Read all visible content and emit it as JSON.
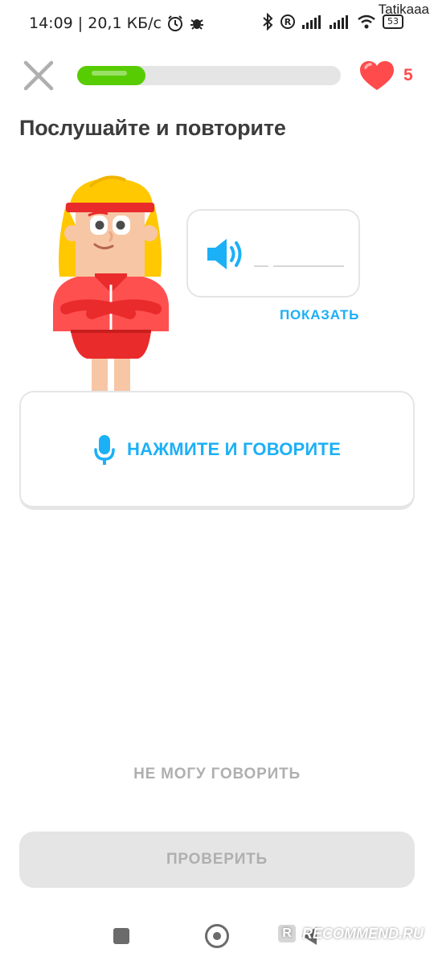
{
  "status_bar": {
    "time_speed": "14:09 | 20,1 КБ/с",
    "battery": "53",
    "icons": [
      "alarm-icon",
      "bug-icon",
      "bluetooth-icon",
      "roaming-icon",
      "signal-icon",
      "wifi-icon",
      "battery-icon"
    ]
  },
  "watermark": {
    "user": "Tatikaaa",
    "site": "RECOMMEND.RU",
    "badge": "R"
  },
  "header": {
    "progress": 0.26,
    "hearts_count": "5"
  },
  "title": "Послушайте и повторите",
  "bubble": {
    "speaker_icon": "speaker-icon"
  },
  "show_label": "ПОКАЗАТЬ",
  "speak_button": {
    "label": "НАЖМИТЕ И ГОВОРИТЕ",
    "icon": "microphone-icon"
  },
  "cant_speak_label": "НЕ МОГУ ГОВОРИТЬ",
  "check_label": "ПРОВЕРИТЬ",
  "colors": {
    "green": "#58cc02",
    "blue": "#1cb0f6",
    "red": "#ff4b4b",
    "gray": "#afafaf",
    "track": "#e5e5e5"
  }
}
